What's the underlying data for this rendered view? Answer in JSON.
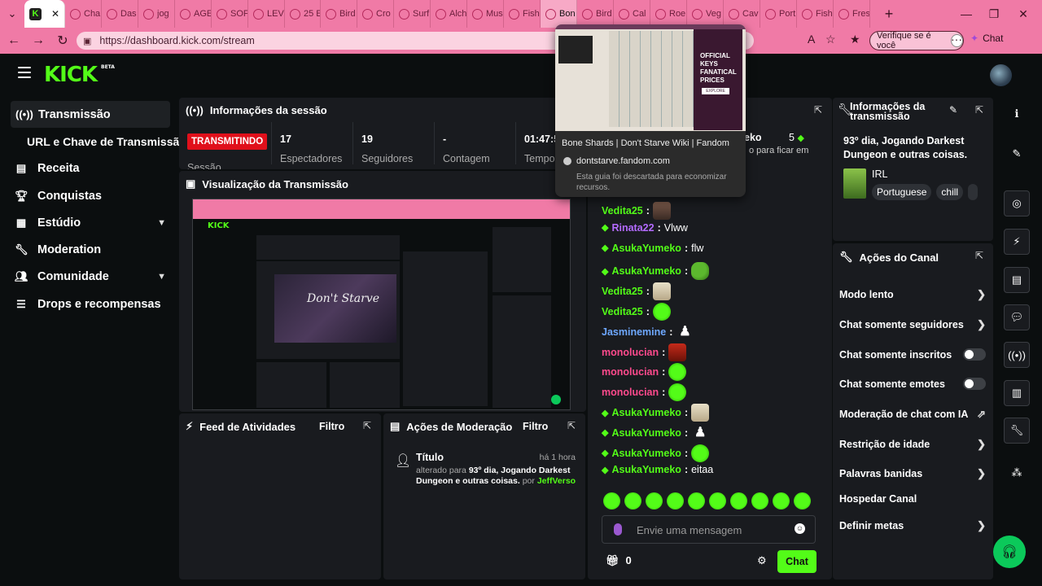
{
  "browser": {
    "tabs": [
      {
        "label": "Cha"
      },
      {
        "label": "Das"
      },
      {
        "label": "jog"
      },
      {
        "label": "AGE"
      },
      {
        "label": "SOF"
      },
      {
        "label": "LEV"
      },
      {
        "label": "25 E"
      },
      {
        "label": "Bird"
      },
      {
        "label": "Cro"
      },
      {
        "label": "Surf"
      },
      {
        "label": "Alch"
      },
      {
        "label": "Mus"
      },
      {
        "label": "Fish"
      },
      {
        "label": "Bon"
      },
      {
        "label": "Bird"
      },
      {
        "label": "Cal"
      },
      {
        "label": "Roe"
      },
      {
        "label": "Veg"
      },
      {
        "label": "Cav"
      },
      {
        "label": "Port"
      },
      {
        "label": "Fish"
      },
      {
        "label": "Fres"
      }
    ],
    "active_tab_icon": "K",
    "url": "https://dashboard.kick.com/stream",
    "verify_label": "Verifique se é você",
    "chat_label": "Chat",
    "tooltip": {
      "title": "Bone Shards | Don't Starve Wiki | Fandom",
      "domain": "dontstarve.fandom.com",
      "note": "Esta guia foi descartada para economizar recursos.",
      "ad_text": "OFFICIAL KEYS FANATICAL PRICES",
      "ad_button": "EXPLORE"
    }
  },
  "brand": {
    "logo": "KICK",
    "beta": "BETA",
    "accent": "#53fc18"
  },
  "sidebar": {
    "items": [
      {
        "label": "Transmissão",
        "icon": "broadcast-icon"
      },
      {
        "label": "URL e Chave de Transmissão"
      },
      {
        "label": "Receita",
        "icon": "wallet-icon"
      },
      {
        "label": "Conquistas",
        "icon": "trophy-icon"
      },
      {
        "label": "Estúdio",
        "icon": "grid-icon"
      },
      {
        "label": "Moderation",
        "icon": "wrench-icon"
      },
      {
        "label": "Comunidade",
        "icon": "people-icon"
      },
      {
        "label": "Drops e recompensas",
        "icon": "list-icon"
      }
    ]
  },
  "session": {
    "title": "Informações da sessão",
    "live_badge": "TRANSMITINDO",
    "session_label": "Sessão",
    "stats": [
      {
        "value": "17",
        "label": "Espectadores"
      },
      {
        "value": "19",
        "label": "Seguidores"
      },
      {
        "value": "-",
        "label": "Contagem"
      },
      {
        "value": "01:47:5",
        "label": "Tempo"
      }
    ]
  },
  "preview": {
    "title": "Visualização da Transmissão",
    "game_logo": "Don't Starve"
  },
  "activity": {
    "title": "Feed de Atividades",
    "filter": "Filtro"
  },
  "moderation": {
    "title": "Ações de Moderação",
    "filter": "Filtro",
    "entry": {
      "heading": "Título",
      "time": "há 1 hora",
      "prefix": "alterado para",
      "value": "93º dia, Jogando Darkest Dungeon e outras coisas.",
      "by": "por",
      "user": "JeffVerso"
    }
  },
  "chat": {
    "top_user": "eko",
    "top_count": "5",
    "top_text": "o para ficar em",
    "messages": [
      {
        "user": "Vedita25",
        "color": "#53fc18",
        "gem": false,
        "text": "",
        "emote": "face"
      },
      {
        "user": "Rinata22",
        "color": "#b46bff",
        "gem": true,
        "text": "Vlww",
        "emote": ""
      },
      {
        "user": "AsukaYumeko",
        "color": "#53fc18",
        "gem": true,
        "text": "flw",
        "emote": ""
      },
      {
        "user": "AsukaYumeko",
        "color": "#53fc18",
        "gem": true,
        "text": "",
        "emote": "pepe"
      },
      {
        "user": "Vedita25",
        "color": "#53fc18",
        "gem": false,
        "text": "",
        "emote": "pale"
      },
      {
        "user": "Vedita25",
        "color": "#53fc18",
        "gem": false,
        "text": "",
        "emote": "green"
      },
      {
        "user": "Jasminemine",
        "color": "#6ea8ff",
        "gem": false,
        "text": "",
        "emote": "white"
      },
      {
        "user": "monolucian",
        "color": "#ff4a8d",
        "gem": false,
        "text": "",
        "emote": "red"
      },
      {
        "user": "monolucian",
        "color": "#ff4a8d",
        "gem": false,
        "text": "",
        "emote": "green"
      },
      {
        "user": "monolucian",
        "color": "#ff4a8d",
        "gem": false,
        "text": "",
        "emote": "green"
      },
      {
        "user": "AsukaYumeko",
        "color": "#53fc18",
        "gem": true,
        "text": "",
        "emote": "pale"
      },
      {
        "user": "AsukaYumeko",
        "color": "#53fc18",
        "gem": true,
        "text": "",
        "emote": "white"
      },
      {
        "user": "AsukaYumeko",
        "color": "#53fc18",
        "gem": true,
        "text": "",
        "emote": "green"
      },
      {
        "user": "AsukaYumeko",
        "color": "#53fc18",
        "gem": true,
        "text": "eitaa",
        "emote": ""
      }
    ],
    "input_placeholder": "Envie uma mensagem",
    "points": "0",
    "send_label": "Chat"
  },
  "stream_info": {
    "title": "Informações da transmissão",
    "stream_title": "93º dia, Jogando Darkest Dungeon e outras coisas.",
    "category": "IRL",
    "tags": [
      "Portuguese",
      "chill"
    ]
  },
  "channel_actions": {
    "title": "Ações do Canal",
    "items": [
      {
        "label": "Modo lento",
        "control": "chevron"
      },
      {
        "label": "Chat somente seguidores",
        "control": "chevron"
      },
      {
        "label": "Chat somente inscritos",
        "control": "toggle"
      },
      {
        "label": "Chat somente emotes",
        "control": "toggle"
      },
      {
        "label": "Moderação de chat com IA",
        "control": "external"
      },
      {
        "label": "Restrição de idade",
        "control": "chevron"
      },
      {
        "label": "Palavras banidas",
        "control": "chevron"
      },
      {
        "label": "Hospedar Canal",
        "control": "none"
      },
      {
        "label": "Definir metas",
        "control": "chevron"
      }
    ]
  }
}
